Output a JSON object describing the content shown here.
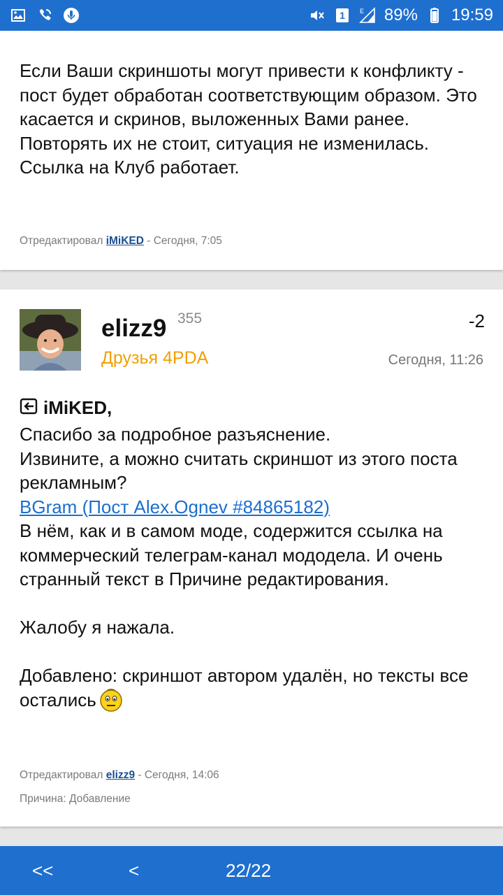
{
  "status_bar": {
    "battery": "89%",
    "time": "19:59",
    "sim_number": "1",
    "network_letter": "E",
    "icons": [
      "image-icon",
      "wifi-call-icon",
      "mic-icon",
      "mute-icon",
      "sim-icon",
      "signal-icon",
      "battery-icon"
    ]
  },
  "post1": {
    "text": "Если Ваши скриншоты могут привести к конфликту - пост будет обработан соответствующим образом. Это касается и скринов, выложенных Вами ранее. Повторять их не стоит, ситуация не изменилась. Ссылка на Клуб работает.",
    "edited_prefix": "Отредактировал",
    "edited_by": "iMiKED",
    "edited_suffix": " - Сегодня, 7:05"
  },
  "post2": {
    "username": "elizz9",
    "reputation": "355",
    "group": "Друзья 4PDA",
    "rating": "-2",
    "time": "Сегодня, 11:26",
    "quote_name": "iMiKED,",
    "line1": "Спасибо за подробное разъяснение.",
    "line2": "Извините, а можно считать скриншот из этого поста рекламным?",
    "link": "BGram (Пост Alex.Ognev #84865182)",
    "para2": "В нём, как и в самом моде, содержится ссылка на коммерческий телеграм-канал мододела. И очень странный текст в Причине редактирования.",
    "para3": "Жалобу я нажала.",
    "para4": "Добавлено: скриншот автором удалён, но тексты все остались",
    "edited_prefix": "Отредактировал",
    "edited_by": "elizz9",
    "edited_suffix": " - Сегодня, 14:06",
    "reason": "Причина: Добавление"
  },
  "bottom_nav": {
    "first": "<<",
    "prev": "<",
    "page": "22/22"
  },
  "colors": {
    "accent": "#1f6fcf",
    "group": "#f0a000",
    "link": "#1a6fcf"
  }
}
